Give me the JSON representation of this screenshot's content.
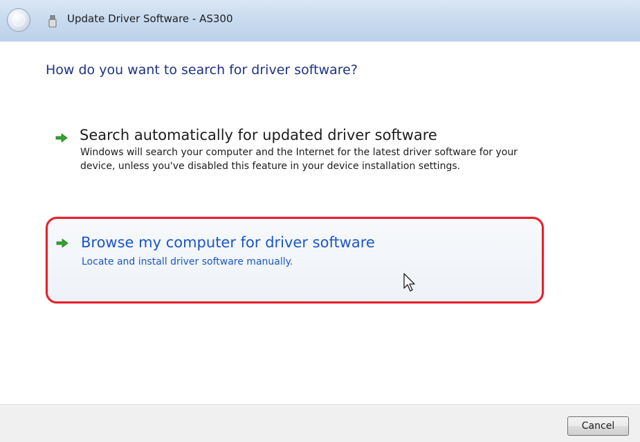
{
  "window": {
    "title": "Update Driver Software - AS300",
    "back_icon": "back-arrow-icon",
    "device_icon": "usb-device-icon"
  },
  "heading": "How do you want to search for driver software?",
  "options": [
    {
      "icon": "green-arrow-icon",
      "title": "Search automatically for updated driver software",
      "description": "Windows will search your computer and the Internet for the latest driver software for your device, unless you've disabled this feature in your device installation settings."
    },
    {
      "icon": "green-arrow-icon",
      "title": "Browse my computer for driver software",
      "description": "Locate and install driver software manually.",
      "highlighted": true
    }
  ],
  "footer": {
    "cancel_label": "Cancel"
  },
  "colors": {
    "heading": "#1e3287",
    "link": "#1a56c9",
    "highlight_border": "#e8202c",
    "arrow": "#2fa52a"
  }
}
